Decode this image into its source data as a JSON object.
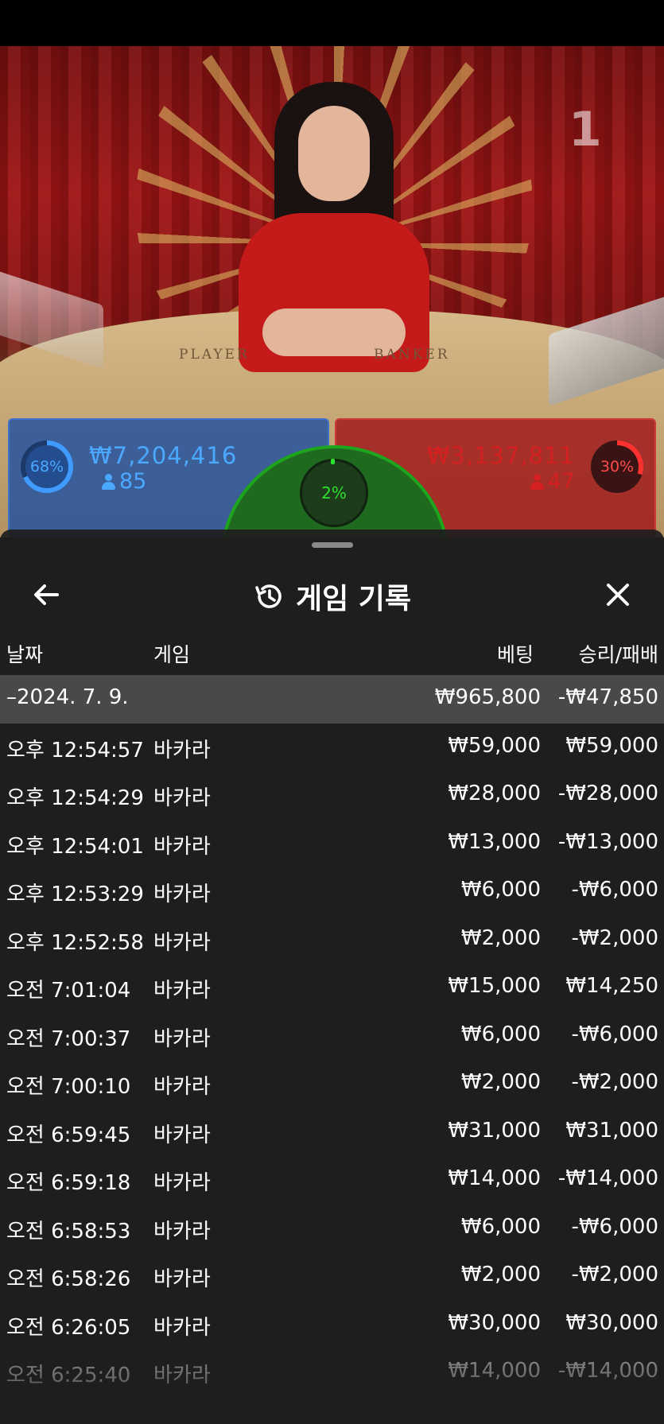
{
  "video": {
    "table_number": "1",
    "player_label": "PLAYER",
    "banker_label": "BANKER"
  },
  "bets": {
    "player": {
      "percent": "68%",
      "amount": "₩7,204,416",
      "count": "85",
      "fill": 0.68
    },
    "tie": {
      "percent": "2%",
      "fill": 0.02
    },
    "banker": {
      "percent": "30%",
      "amount": "₩3,137,811",
      "count": "47",
      "fill": 0.3
    }
  },
  "history": {
    "title": "게임 기록",
    "columns": {
      "date": "날짜",
      "game": "게임",
      "bet": "베팅",
      "win_loss": "승리/패배"
    },
    "summary": {
      "date": "–2024. 7. 9.",
      "bet": "₩965,800",
      "win_loss": "-₩47,850"
    },
    "rows": [
      {
        "date": "오후 12:54:57",
        "game": "바카라",
        "bet": "₩59,000",
        "win_loss": "₩59,000"
      },
      {
        "date": "오후 12:54:29",
        "game": "바카라",
        "bet": "₩28,000",
        "win_loss": "-₩28,000"
      },
      {
        "date": "오후 12:54:01",
        "game": "바카라",
        "bet": "₩13,000",
        "win_loss": "-₩13,000"
      },
      {
        "date": "오후 12:53:29",
        "game": "바카라",
        "bet": "₩6,000",
        "win_loss": "-₩6,000"
      },
      {
        "date": "오후 12:52:58",
        "game": "바카라",
        "bet": "₩2,000",
        "win_loss": "-₩2,000"
      },
      {
        "date": "오전 7:01:04",
        "game": "바카라",
        "bet": "₩15,000",
        "win_loss": "₩14,250"
      },
      {
        "date": "오전 7:00:37",
        "game": "바카라",
        "bet": "₩6,000",
        "win_loss": "-₩6,000"
      },
      {
        "date": "오전 7:00:10",
        "game": "바카라",
        "bet": "₩2,000",
        "win_loss": "-₩2,000"
      },
      {
        "date": "오전 6:59:45",
        "game": "바카라",
        "bet": "₩31,000",
        "win_loss": "₩31,000"
      },
      {
        "date": "오전 6:59:18",
        "game": "바카라",
        "bet": "₩14,000",
        "win_loss": "-₩14,000"
      },
      {
        "date": "오전 6:58:53",
        "game": "바카라",
        "bet": "₩6,000",
        "win_loss": "-₩6,000"
      },
      {
        "date": "오전 6:58:26",
        "game": "바카라",
        "bet": "₩2,000",
        "win_loss": "-₩2,000"
      },
      {
        "date": "오전 6:26:05",
        "game": "바카라",
        "bet": "₩30,000",
        "win_loss": "₩30,000"
      },
      {
        "date": "오전 6:25:40",
        "game": "바카라",
        "bet": "₩14,000",
        "win_loss": "-₩14,000"
      }
    ]
  },
  "icons": {
    "back": "arrow-left-icon",
    "history": "history-icon",
    "close": "close-icon",
    "person": "person-icon"
  },
  "colors": {
    "player": "#3f9bff",
    "banker": "#ff3030",
    "tie": "#2ee22e",
    "sheet": "#1e1e1e"
  }
}
